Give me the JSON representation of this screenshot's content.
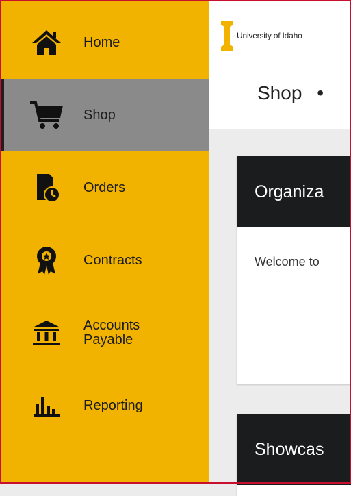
{
  "sidebar": {
    "items": [
      {
        "label": "Home",
        "icon": "home-icon",
        "active": false
      },
      {
        "label": "Shop",
        "icon": "shopping-cart-icon",
        "active": true
      },
      {
        "label": "Orders",
        "icon": "orders-clock-icon",
        "active": false
      },
      {
        "label": "Contracts",
        "icon": "award-ribbon-icon",
        "active": false
      },
      {
        "label": "Accounts\nPayable",
        "icon": "bank-building-icon",
        "active": false
      },
      {
        "label": "Reporting",
        "icon": "bar-chart-icon",
        "active": false
      }
    ]
  },
  "header": {
    "logo_text": "University of Idaho",
    "breadcrumb": "Shop",
    "separator": "•"
  },
  "cards": [
    {
      "title": "Organiza",
      "body": "Welcome to"
    },
    {
      "title": "Showcas",
      "body": ""
    }
  ],
  "colors": {
    "sidebar_bg": "#f1b300",
    "active_bg": "#8a8a8a",
    "card_header_bg": "#1b1c1e",
    "frame_border": "#c8102e"
  }
}
